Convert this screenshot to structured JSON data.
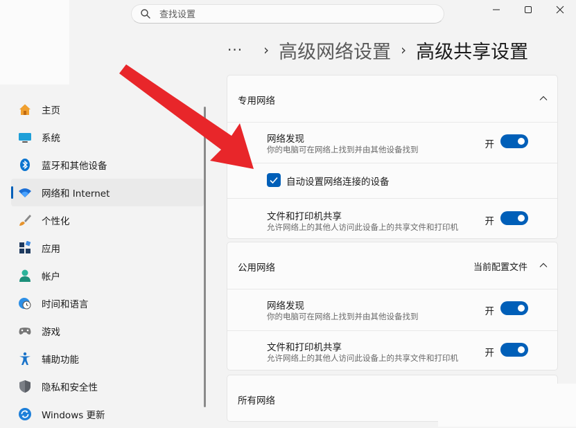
{
  "search": {
    "placeholder": "查找设置"
  },
  "window_controls": [
    "minimize-icon",
    "maximize-icon",
    "close-icon"
  ],
  "breadcrumb": {
    "more": "···",
    "separator": "›",
    "parent": "高级网络设置",
    "current": "高级共享设置"
  },
  "sidebar": {
    "items": [
      {
        "label": "主页",
        "icon": "home-icon"
      },
      {
        "label": "系统",
        "icon": "system-icon"
      },
      {
        "label": "蓝牙和其他设备",
        "icon": "bluetooth-icon"
      },
      {
        "label": "网络和 Internet",
        "icon": "wifi-icon",
        "active": true
      },
      {
        "label": "个性化",
        "icon": "brush-icon"
      },
      {
        "label": "应用",
        "icon": "apps-icon"
      },
      {
        "label": "帐户",
        "icon": "account-icon"
      },
      {
        "label": "时间和语言",
        "icon": "clock-globe-icon"
      },
      {
        "label": "游戏",
        "icon": "gamepad-icon"
      },
      {
        "label": "辅助功能",
        "icon": "accessibility-icon"
      },
      {
        "label": "隐私和安全性",
        "icon": "shield-icon"
      },
      {
        "label": "Windows 更新",
        "icon": "windows-update-icon"
      }
    ]
  },
  "private_network": {
    "title": "专用网络",
    "discovery": {
      "title": "网络发现",
      "subtitle": "你的电脑可在网络上找到并由其他设备找到",
      "state": "开"
    },
    "auto_setup": {
      "label": "自动设置网络连接的设备",
      "checked": true
    },
    "file_sharing": {
      "title": "文件和打印机共享",
      "subtitle": "允许网络上的其他人访问此设备上的共享文件和打印机",
      "state": "开"
    }
  },
  "public_network": {
    "title": "公用网络",
    "current_profile": "当前配置文件",
    "discovery": {
      "title": "网络发现",
      "subtitle": "你的电脑可在网络上找到并由其他设备找到",
      "state": "开"
    },
    "file_sharing": {
      "title": "文件和打印机共享",
      "subtitle": "允许网络上的其他人访问此设备上的共享文件和打印机",
      "state": "开"
    }
  },
  "all_networks": {
    "title": "所有网络"
  },
  "colors": {
    "accent": "#005fb8",
    "arrow": "#e8262a",
    "background": "#f3f3f3",
    "card": "#fbfbfb"
  }
}
